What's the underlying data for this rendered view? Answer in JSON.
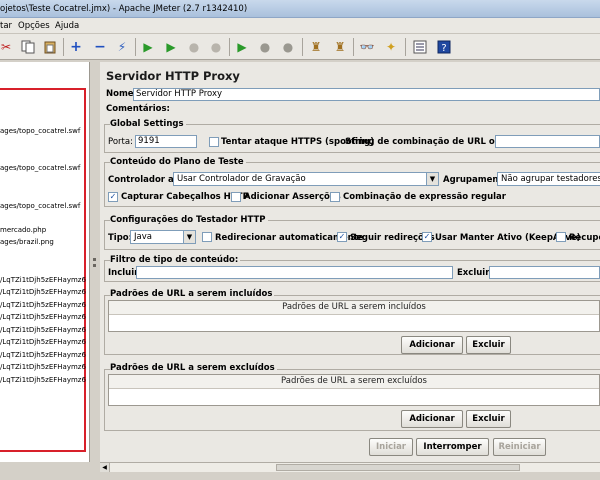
{
  "window": {
    "title": "ojetos\\Teste Cocatrel.jmx) - Apache JMeter (2.7 r1342410)"
  },
  "menu": [
    "tar",
    "Opções",
    "Ajuda"
  ],
  "toolbar_icons": [
    "scissors-icon",
    "copy-icon",
    "paste-icon",
    "expand-icon",
    "collapse-icon",
    "toggle-icon",
    "start-icon",
    "start-no-pause-icon",
    "stop-icon",
    "shutdown-icon",
    "remote-start-icon",
    "remote-stop-icon",
    "remote-shutdown-icon",
    "clear-icon",
    "clear-all-icon",
    "search-icon",
    "reset-search-icon",
    "function-helper-icon",
    "help-icon"
  ],
  "tree": {
    "items": [
      "ages/topo_cocatrel.swf",
      "ages/topo_cocatrel.swf",
      "ages/topo_cocatrel.swf",
      "mercado.php",
      "ages/brazil.png",
      "/LqTZi1tDjh5zEFHaymz6",
      "/LqTZi1tDjh5zEFHaymz6",
      "/LqTZi1tDjh5zEFHaymz6",
      "/LqTZi1tDjh5zEFHaymz6",
      "/LqTZi1tDjh5zEFHaymz6",
      "/LqTZi1tDjh5zEFHaymz6",
      "/LqTZi1tDjh5zEFHaymz6",
      "/LqTZi1tDjh5zEFHaymz6",
      "/LqTZi1tDjh5zEFHaymz6"
    ]
  },
  "panel": {
    "title": "Servidor HTTP Proxy",
    "name_label": "Nome:",
    "name_value": "Servidor HTTP Proxy",
    "comments_label": "Comentários:",
    "global": {
      "title": "Global Settings",
      "port_label": "Porta:",
      "port_value": "9191",
      "https_label": "Tentar ataque  HTTPS (spoofing)",
      "url_match_label": "String de combinação de URL opcional:",
      "url_match_value": ""
    },
    "content": {
      "title": "Conteúdo do Plano de Teste",
      "target_label": "Controlador alvo:",
      "target_value": "Usar Controlador de Gravação",
      "grouping_label": "Agrupamento:",
      "grouping_value": "Não agrupar testadores",
      "capture_headers": "Capturar Cabeçalhos HTTP",
      "add_assertions": "Adicionar Asserções",
      "regex_match": "Combinação de expressão regular"
    },
    "sampler": {
      "title": "Configurações do Testador HTTP",
      "type_label": "Tipo:",
      "type_value": "Java",
      "auto_redirect": "Redirecionar automaticamente",
      "follow_redirects": "Seguir redireções",
      "keepalive": "Usar Manter Ativo (KeepAlive)",
      "retrieve": "Recupera"
    },
    "filter": {
      "title": "Filtro de tipo de conteúdo:",
      "include_label": "Incluir:",
      "include_value": "",
      "exclude_label": "Excluir:",
      "exclude_value": ""
    },
    "include_patterns": {
      "title": "Padrões de URL a serem incluídos",
      "column": "Padrões de URL a serem incluídos",
      "add": "Adicionar",
      "remove": "Excluir"
    },
    "exclude_patterns": {
      "title": "Padrões de URL a serem excluídos",
      "column": "Padrões de URL a serem excluídos",
      "add": "Adicionar",
      "remove": "Excluir"
    },
    "actions": {
      "start": "Iniciar",
      "stop": "Interromper",
      "restart": "Reiniciar"
    }
  }
}
